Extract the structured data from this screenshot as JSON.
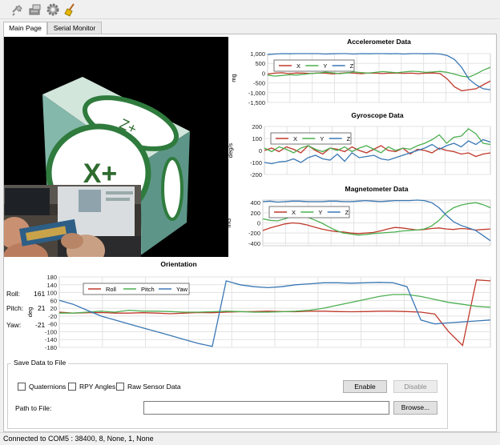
{
  "toolbar": {
    "buttons": [
      {
        "icon": "connect-plug-icon"
      },
      {
        "icon": "write-device-icon"
      },
      {
        "icon": "settings-gear-icon"
      },
      {
        "icon": "clear-broom-icon"
      }
    ]
  },
  "tabs": [
    {
      "label": "Main Page",
      "active": true
    },
    {
      "label": "Serial Monitor",
      "active": false
    }
  ],
  "cube": {
    "face_front": "X+",
    "face_top": "Z+"
  },
  "orientation_values": {
    "roll_label": "Roll:",
    "roll": "161",
    "pitch_label": "Pitch:",
    "pitch": "21",
    "yaw_label": "Yaw:",
    "yaw": "-21"
  },
  "save": {
    "group_title": "Save Data to File",
    "quaternions_label": "Quaternions",
    "rpy_label": "RPY Angles",
    "raw_label": "Raw Sensor Data",
    "enable_label": "Enable",
    "disable_label": "Disable",
    "path_label": "Path to File:",
    "path_value": "",
    "browse_label": "Browse..."
  },
  "status": {
    "text": "Connected to COM5 : 38400, 8, None, 1, None"
  },
  "colors": {
    "red": "#c0392b",
    "green": "#4caf50",
    "blue": "#3a78b5",
    "grid": "#e3e3e3"
  },
  "chart_data": [
    {
      "type": "line",
      "title": "Accelerometer Data",
      "ylabel": "mg",
      "yticks": [
        "1,000",
        "500",
        "0",
        "-500",
        "-1,000",
        "-1,500"
      ],
      "ylim": [
        -1500,
        1000
      ],
      "legend": "top-left",
      "series": [
        {
          "name": "X",
          "color": "#c0392b",
          "values": [
            -50,
            0,
            20,
            -30,
            10,
            0,
            -20,
            10,
            0,
            -40,
            -10,
            20,
            0,
            -30,
            10,
            0,
            -20,
            0,
            10,
            -10,
            0,
            -30,
            0,
            10,
            -20,
            -300,
            -700,
            -900,
            -850,
            -800,
            -600,
            -400
          ]
        },
        {
          "name": "Y",
          "color": "#4caf50",
          "values": [
            -100,
            -150,
            -120,
            -80,
            -100,
            -60,
            -20,
            0,
            50,
            20,
            -30,
            10,
            60,
            30,
            0,
            40,
            80,
            50,
            20,
            60,
            100,
            80,
            40,
            60,
            90,
            40,
            -50,
            -150,
            -200,
            -50,
            150,
            300
          ]
        },
        {
          "name": "Z",
          "color": "#3a78b5",
          "values": [
            950,
            980,
            1000,
            990,
            1000,
            1000,
            1000,
            1000,
            980,
            990,
            1000,
            1000,
            980,
            1000,
            990,
            1000,
            1000,
            990,
            1000,
            980,
            1000,
            1000,
            990,
            1000,
            980,
            900,
            700,
            300,
            -300,
            -600,
            -800,
            -850
          ]
        }
      ]
    },
    {
      "type": "line",
      "title": "Gyroscope Data",
      "ylabel": "deg/s",
      "yticks": [
        "200",
        "100",
        "0",
        "-100",
        "-200"
      ],
      "ylim": [
        -200,
        200
      ],
      "legend": "top-left",
      "series": [
        {
          "name": "X",
          "color": "#c0392b",
          "values": [
            0,
            20,
            -10,
            30,
            10,
            -20,
            40,
            0,
            -30,
            20,
            10,
            -10,
            30,
            0,
            -20,
            10,
            40,
            0,
            -10,
            20,
            -30,
            10,
            0,
            -20,
            20,
            0,
            -10,
            -30,
            -20,
            -50,
            -30,
            -20
          ]
        },
        {
          "name": "Y",
          "color": "#4caf50",
          "values": [
            20,
            -10,
            30,
            10,
            -20,
            20,
            40,
            10,
            -10,
            20,
            0,
            30,
            -10,
            20,
            40,
            10,
            -20,
            30,
            0,
            20,
            10,
            40,
            60,
            90,
            130,
            60,
            110,
            120,
            180,
            140,
            60,
            50
          ]
        },
        {
          "name": "Z",
          "color": "#3a78b5",
          "values": [
            -100,
            -110,
            -95,
            -90,
            -70,
            -100,
            -60,
            -40,
            -70,
            -80,
            -30,
            -90,
            -20,
            -60,
            -50,
            -40,
            -70,
            -80,
            -60,
            -40,
            -20,
            0,
            20,
            50,
            10,
            40,
            60,
            30,
            80,
            50,
            90,
            70
          ]
        }
      ]
    },
    {
      "type": "line",
      "title": "Magnetometer Data",
      "ylabel": "mG",
      "yticks": [
        "400",
        "200",
        "0",
        "-200",
        "-400"
      ],
      "ylim": [
        -450,
        450
      ],
      "legend": "top-left",
      "series": [
        {
          "name": "X",
          "color": "#c0392b",
          "values": [
            -150,
            -100,
            -60,
            -20,
            0,
            -10,
            -40,
            -80,
            -120,
            -150,
            -170,
            -180,
            -200,
            -210,
            -200,
            -190,
            -160,
            -120,
            -90,
            -100,
            -120,
            -140,
            -130,
            -110,
            -100,
            -120,
            -130,
            -110,
            -120,
            -140,
            -130,
            -120
          ]
        },
        {
          "name": "Y",
          "color": "#4caf50",
          "values": [
            80,
            50,
            40,
            80,
            130,
            150,
            120,
            60,
            0,
            -80,
            -150,
            -200,
            -220,
            -240,
            -230,
            -210,
            -200,
            -190,
            -180,
            -160,
            -150,
            -140,
            -120,
            -60,
            50,
            200,
            300,
            350,
            380,
            400,
            360,
            300
          ]
        },
        {
          "name": "Z",
          "color": "#3a78b5",
          "values": [
            420,
            430,
            410,
            420,
            430,
            430,
            420,
            420,
            420,
            430,
            430,
            420,
            420,
            430,
            440,
            430,
            420,
            430,
            440,
            440,
            440,
            450,
            440,
            400,
            300,
            150,
            20,
            -50,
            -100,
            -150,
            -250,
            -350
          ]
        }
      ]
    },
    {
      "type": "line",
      "title": "Orientation",
      "ylabel": "deg",
      "yticks": [
        "180",
        "140",
        "100",
        "60",
        "20",
        "-20",
        "-60",
        "-100",
        "-140",
        "-180"
      ],
      "ylim": [
        -180,
        180
      ],
      "legend": "top-left",
      "series": [
        {
          "name": "Roll",
          "color": "#c0392b",
          "values": [
            0,
            -5,
            -3,
            -2,
            -5,
            -5,
            -3,
            -5,
            -8,
            -5,
            -2,
            -3,
            0,
            2,
            3,
            5,
            3,
            2,
            5,
            5,
            3,
            2,
            3,
            5,
            5,
            3,
            0,
            -10,
            -100,
            -170,
            165,
            160
          ]
        },
        {
          "name": "Pitch",
          "color": "#4caf50",
          "values": [
            -5,
            -5,
            0,
            5,
            0,
            10,
            5,
            5,
            3,
            0,
            0,
            2,
            5,
            3,
            0,
            0,
            2,
            5,
            10,
            20,
            35,
            50,
            65,
            80,
            90,
            90,
            80,
            65,
            50,
            40,
            30,
            25
          ]
        },
        {
          "name": "Yaw",
          "color": "#3a78b5",
          "values": [
            60,
            40,
            10,
            -20,
            -40,
            -60,
            -80,
            -100,
            -120,
            -140,
            -160,
            -175,
            160,
            140,
            130,
            125,
            130,
            140,
            145,
            150,
            150,
            148,
            150,
            152,
            150,
            130,
            -40,
            -60,
            -55,
            -50,
            -45,
            -40
          ]
        }
      ]
    }
  ]
}
